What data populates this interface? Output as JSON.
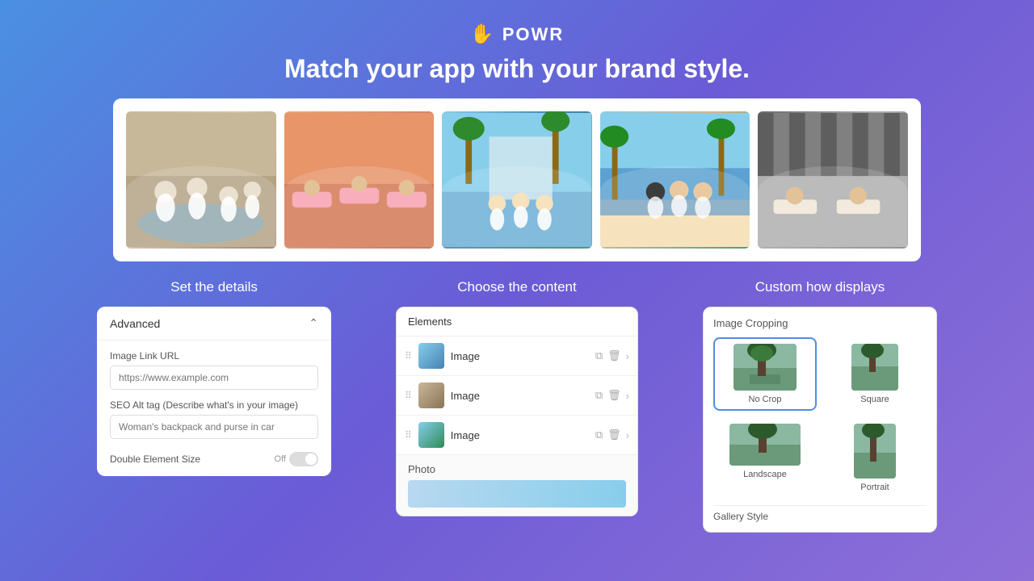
{
  "header": {
    "logo_text": "POWR",
    "logo_icon": "☎",
    "tagline": "Match your app with your brand style."
  },
  "gallery": {
    "images": [
      {
        "alt": "spa group 1",
        "gradient": "img-1"
      },
      {
        "alt": "spa group 2",
        "gradient": "img-2"
      },
      {
        "alt": "spa group 3",
        "gradient": "img-3"
      },
      {
        "alt": "spa group 4",
        "gradient": "img-4"
      },
      {
        "alt": "spa group 5",
        "gradient": "img-5"
      }
    ]
  },
  "columns": {
    "col1": {
      "title": "Set the details"
    },
    "col2": {
      "title": "Choose the content"
    },
    "col3": {
      "title": "Custom how displays"
    }
  },
  "left_panel": {
    "header": "Advanced",
    "image_link_label": "Image Link URL",
    "image_link_placeholder": "https://www.example.com",
    "seo_label": "SEO Alt tag (Describe what's in your image)",
    "seo_placeholder": "Woman's backpack and purse in car",
    "toggle_label": "Double Element Size",
    "toggle_value": "Off"
  },
  "middle_panel": {
    "elements_label": "Elements",
    "items": [
      {
        "name": "Image"
      },
      {
        "name": "Image"
      },
      {
        "name": "Image"
      }
    ],
    "photo_section_label": "Photo"
  },
  "right_panel": {
    "title": "Image Cropping",
    "options": [
      {
        "label": "No Crop",
        "selected": true
      },
      {
        "label": "Square",
        "selected": false
      },
      {
        "label": "Landscape",
        "selected": false
      },
      {
        "label": "Portrait",
        "selected": false
      }
    ],
    "gallery_style_label": "Gallery Style"
  }
}
